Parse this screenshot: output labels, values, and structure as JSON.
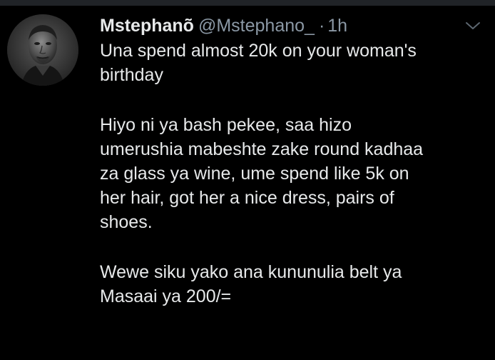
{
  "tweet": {
    "author": {
      "display_name": "Mstephanõ",
      "handle": "@Mstephano_",
      "avatar": "avatar-portrait"
    },
    "separator": "·",
    "timestamp": "1h",
    "menu_icon": "chevron-down-icon",
    "paragraphs": [
      "Una spend almost 20k on your woman's\nbirthday",
      "Hiyo ni ya bash pekee, saa hizo\numerushia mabeshte zake round kadhaa\nza glass ya wine, ume spend like 5k on\nher hair, got her a nice dress, pairs of\nshoes.",
      "Wewe siku yako ana kununulia belt ya\nMasaai ya 200/="
    ]
  },
  "colors": {
    "background": "#000000",
    "divider": "#202327",
    "primary_text": "#e7e9ea",
    "secondary_text": "#8b98a5"
  }
}
